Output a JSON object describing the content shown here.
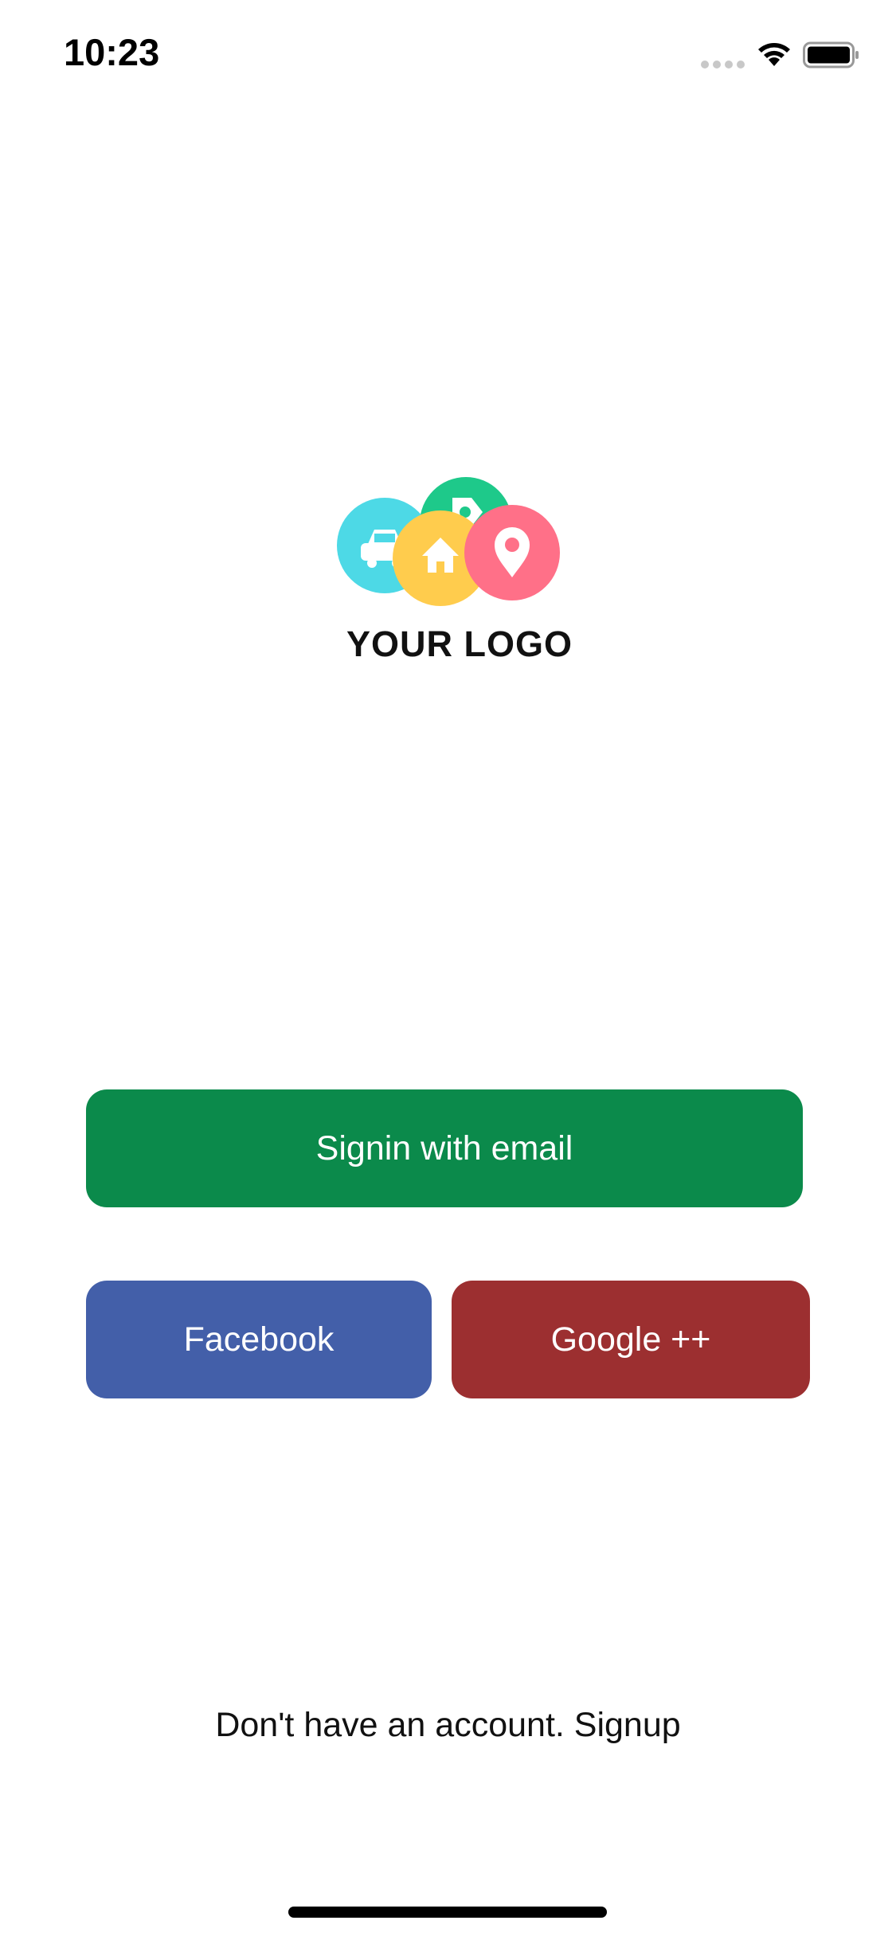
{
  "status_bar": {
    "time": "10:23",
    "icons": [
      "signal-dots-icon",
      "wifi-icon",
      "battery-icon"
    ]
  },
  "logo": {
    "text": "YOUR LOGO",
    "circles": [
      {
        "color": "#4dd9e6",
        "icon": "car-icon"
      },
      {
        "color": "#1ec98a",
        "icon": "tag-icon"
      },
      {
        "color": "#ffcc4d",
        "icon": "home-icon"
      },
      {
        "color": "#ff7088",
        "icon": "location-pin-icon"
      }
    ]
  },
  "buttons": {
    "email": {
      "label": "Signin with email",
      "color": "#0b8a4b"
    },
    "facebook": {
      "label": "Facebook",
      "color": "#435fa9"
    },
    "google": {
      "label": "Google ++",
      "color": "#9c2f30"
    }
  },
  "footer": {
    "signup_text": "Don't have an account. Signup"
  }
}
